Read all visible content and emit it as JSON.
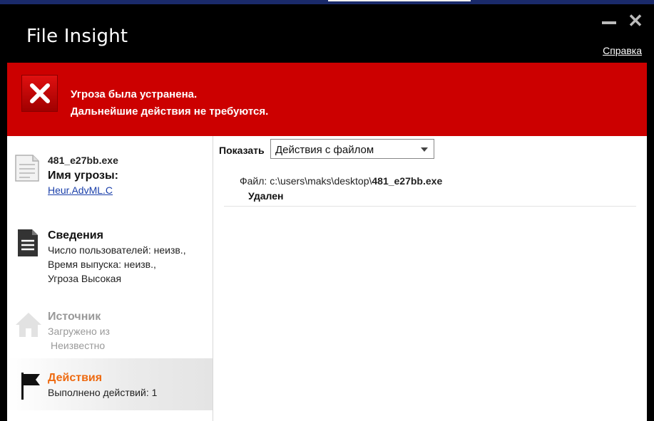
{
  "app": {
    "title": "File Insight",
    "help_label": "Справка"
  },
  "banner": {
    "line1": "Угроза была устранена.",
    "line2": "Дальнейшие действия не требуются."
  },
  "sidebar": {
    "file": {
      "name": "481_e27bb.exe",
      "threat_label": "Имя угрозы:",
      "threat_value": "Heur.AdvML.C"
    },
    "info": {
      "title": "Сведения",
      "users": "Число пользователей: неизв.,",
      "release": "Время выпуска: неизв.,",
      "level": "Угроза Высокая"
    },
    "source": {
      "title": "Источник",
      "line1": "Загружено из",
      "line2": "Неизвестно"
    },
    "actions": {
      "title": "Действия",
      "count": "Выполнено действий: 1"
    }
  },
  "main": {
    "show_label": "Показать",
    "show_value": "Действия с файлом",
    "file_prefix": "Файл: c:\\users\\maks\\desktop\\",
    "file_name": "481_e27bb.exe",
    "status": "Удален"
  },
  "colors": {
    "banner": "#cc0000",
    "accent": "#ee6a10",
    "link": "#1a3faa"
  }
}
